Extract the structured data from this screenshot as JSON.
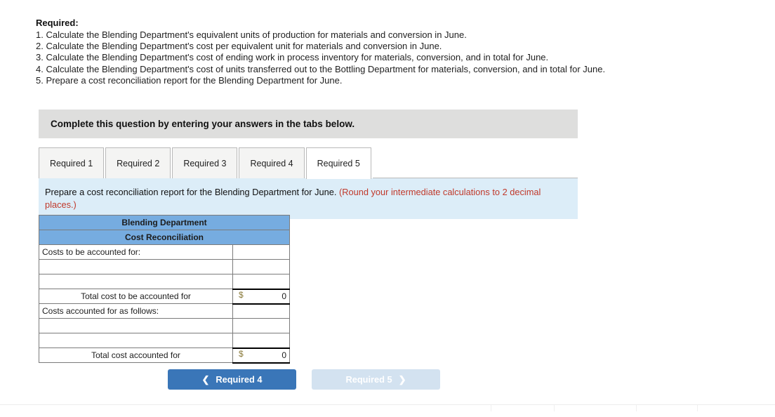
{
  "required": {
    "heading": "Required:",
    "items": [
      "1. Calculate the Blending Department's equivalent units of production for materials and conversion in June.",
      "2. Calculate the Blending Department's cost per equivalent unit for materials and conversion in June.",
      "3. Calculate the Blending Department's cost of ending work in process inventory for materials, conversion, and in total for June.",
      "4. Calculate the Blending Department's cost of units transferred out to the Bottling Department for materials, conversion, and in total for June.",
      "5. Prepare a cost reconciliation report for the Blending Department for June."
    ]
  },
  "instruction_bar": {
    "text": "Complete this question by entering your answers in the tabs below."
  },
  "tabs": [
    {
      "label": "Required 1",
      "active": false
    },
    {
      "label": "Required 2",
      "active": false
    },
    {
      "label": "Required 3",
      "active": false
    },
    {
      "label": "Required 4",
      "active": false
    },
    {
      "label": "Required 5",
      "active": true
    }
  ],
  "info_banner": {
    "text": "Prepare a cost reconciliation report for the Blending Department for June. ",
    "note": "(Round your intermediate calculations to 2 decimal places.)"
  },
  "worksheet": {
    "title_line_1": "Blending Department",
    "title_line_2": "Cost Reconciliation",
    "rows": [
      {
        "label": "Costs to be accounted for:",
        "style": "left",
        "value": "",
        "currency": "",
        "total": false
      },
      {
        "label": "",
        "style": "left",
        "value": "",
        "currency": "",
        "total": false
      },
      {
        "label": "",
        "style": "left",
        "value": "",
        "currency": "",
        "total": false
      },
      {
        "label": "Total cost to be accounted for",
        "style": "indent",
        "value": "0",
        "currency": "$",
        "total": true
      },
      {
        "label": "Costs accounted for as follows:",
        "style": "left",
        "value": "",
        "currency": "",
        "total": false
      },
      {
        "label": "",
        "style": "left",
        "value": "",
        "currency": "",
        "total": false
      },
      {
        "label": "",
        "style": "left",
        "value": "",
        "currency": "",
        "total": false
      },
      {
        "label": "Total cost accounted for",
        "style": "indent",
        "value": "0",
        "currency": "$",
        "total": true
      }
    ]
  },
  "nav": {
    "prev_label": "Required 4",
    "prev_icon": "chevron-left-icon",
    "next_label": "Required 5",
    "next_icon": "chevron-right-icon"
  },
  "colors": {
    "table_header_blue": "#76ace0",
    "info_banner_blue": "#dcedf8",
    "instruction_grey": "#dededd",
    "note_red": "#c0392b",
    "button_blue": "#3a76b8",
    "button_disabled_blue": "#d3e2f0"
  }
}
